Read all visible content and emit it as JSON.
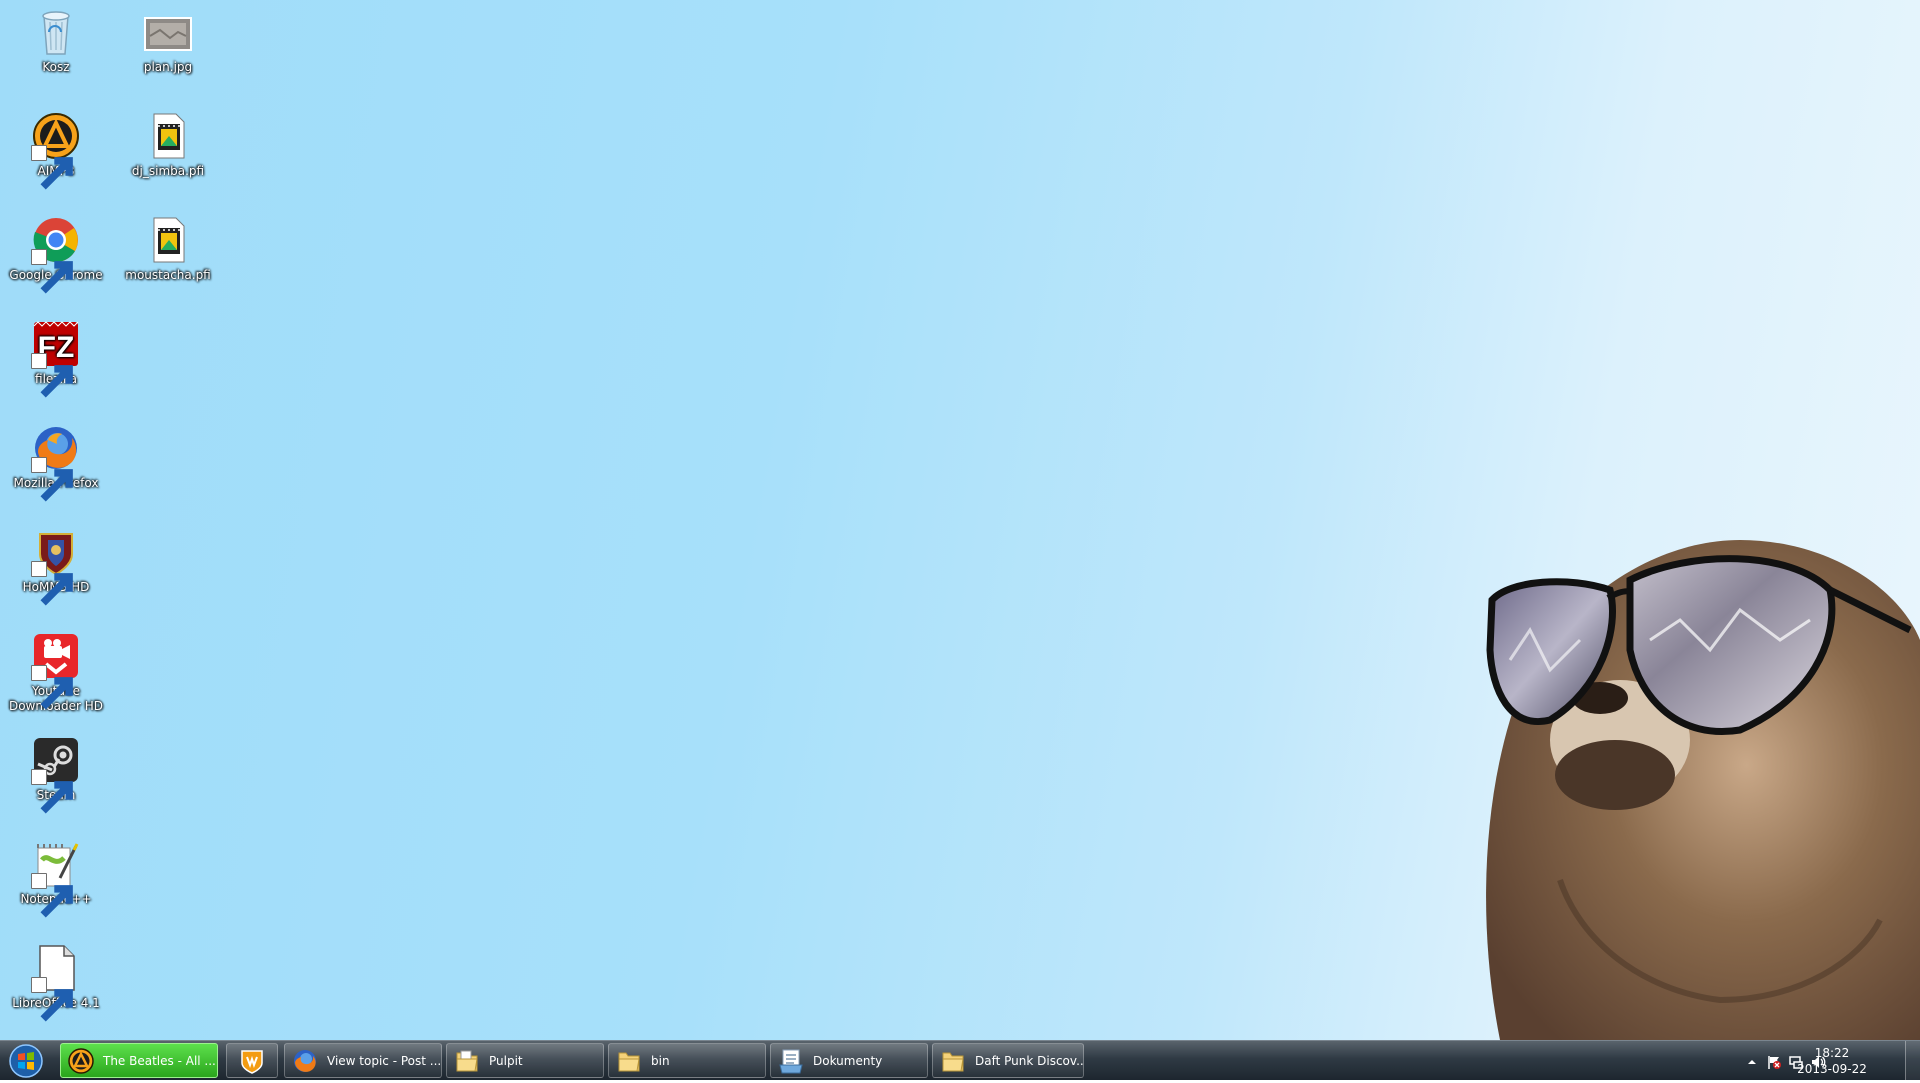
{
  "desktop": {
    "icons": [
      {
        "label": "Kosz",
        "icon": "recycle-bin-icon"
      },
      {
        "label": "plan.jpg",
        "icon": "image-file-icon"
      },
      {
        "label": "AIMP3",
        "icon": "aimp-icon"
      },
      {
        "label": "dj_simba.pfi",
        "icon": "pfi-file-icon"
      },
      {
        "label": "Google Chrome",
        "icon": "chrome-icon"
      },
      {
        "label": "moustacha.pfi",
        "icon": "pfi-file-icon"
      },
      {
        "label": "filezilla",
        "icon": "filezilla-icon"
      },
      {
        "label": "Mozilla Firefox",
        "icon": "firefox-icon"
      },
      {
        "label": "HoMM3 HD",
        "icon": "homm3-icon"
      },
      {
        "label": "Youtube Downloader HD",
        "icon": "youtube-downloader-icon"
      },
      {
        "label": "Steam",
        "icon": "steam-icon"
      },
      {
        "label": "Notepad++",
        "icon": "notepadpp-icon"
      },
      {
        "label": "LibreOffice 4.1",
        "icon": "libreoffice-icon"
      }
    ]
  },
  "taskbar": {
    "tasks": [
      {
        "label": "The Beatles - All ...",
        "icon": "aimp-icon",
        "active": true
      },
      {
        "label": "",
        "icon": "pinned-app-icon"
      },
      {
        "label": "View topic - Post ...",
        "icon": "firefox-icon"
      },
      {
        "label": "Pulpit",
        "icon": "folder-icon"
      },
      {
        "label": "bin",
        "icon": "folder-icon"
      },
      {
        "label": "Dokumenty",
        "icon": "documents-icon"
      },
      {
        "label": "Daft Punk Discov...",
        "icon": "folder-icon"
      }
    ],
    "tray": {
      "time": "18:22",
      "date": "2013-09-22"
    }
  },
  "colors": {
    "wallpaper_sky": "#a7e0fa",
    "taskbar": "#2f3a44",
    "active_task": "#3ec22c"
  }
}
